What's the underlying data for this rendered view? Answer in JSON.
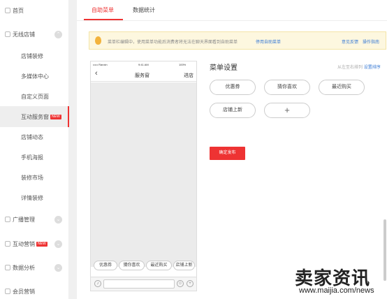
{
  "sidebar": {
    "home": "首页",
    "wireless_store": "无线店铺",
    "store_decoration": "店铺装修",
    "media_center": "多媒体中心",
    "custom_page": "自定义页面",
    "interactive_window": "互动服务窗",
    "store_news": "店铺动态",
    "mobile_poster": "手机海报",
    "decoration_market": "装修市场",
    "detail_decoration": "详情装修",
    "broadcast_management": "广播管理",
    "interactive_marketing": "互动营销",
    "data_analysis": "数据分析",
    "member_marketing": "会员营销",
    "new_badge": "NEW"
  },
  "tabs": [
    "自助菜单",
    "数据统计"
  ],
  "notice": {
    "text": "菜单栏编辑中，使用菜单功能后消费者将无法在聊天界面看到自助菜单",
    "disable_link": "停用自助菜单",
    "feedback_link": "意见反馈",
    "guide_link": "操作指南"
  },
  "phone": {
    "carrier": "••••• Ranxin",
    "time": "9:41 AM",
    "battery": "100%",
    "back": "‹",
    "title": "服务窗",
    "enter_store": "进店",
    "quick_buttons": [
      "优惠券",
      "猜你喜欢",
      "最近购买",
      "店铺上新"
    ],
    "voice_icon": "mic-icon",
    "emoji_icon": "smile-icon",
    "plus_icon": "+"
  },
  "menu_settings": {
    "title": "菜单设置",
    "hint": "从左至右排列",
    "sort_link": "设置排序",
    "items": [
      "优惠券",
      "猜你喜欢",
      "最近购买",
      "店铺上新"
    ],
    "add_label": "+",
    "publish_button": "确定发布"
  },
  "watermark": {
    "logo": "卖家资讯",
    "url": "www.maijia.com/news"
  },
  "colors": {
    "accent": "#ee3333",
    "link": "#3a7bd5",
    "notice_bg": "#fdf7df"
  }
}
